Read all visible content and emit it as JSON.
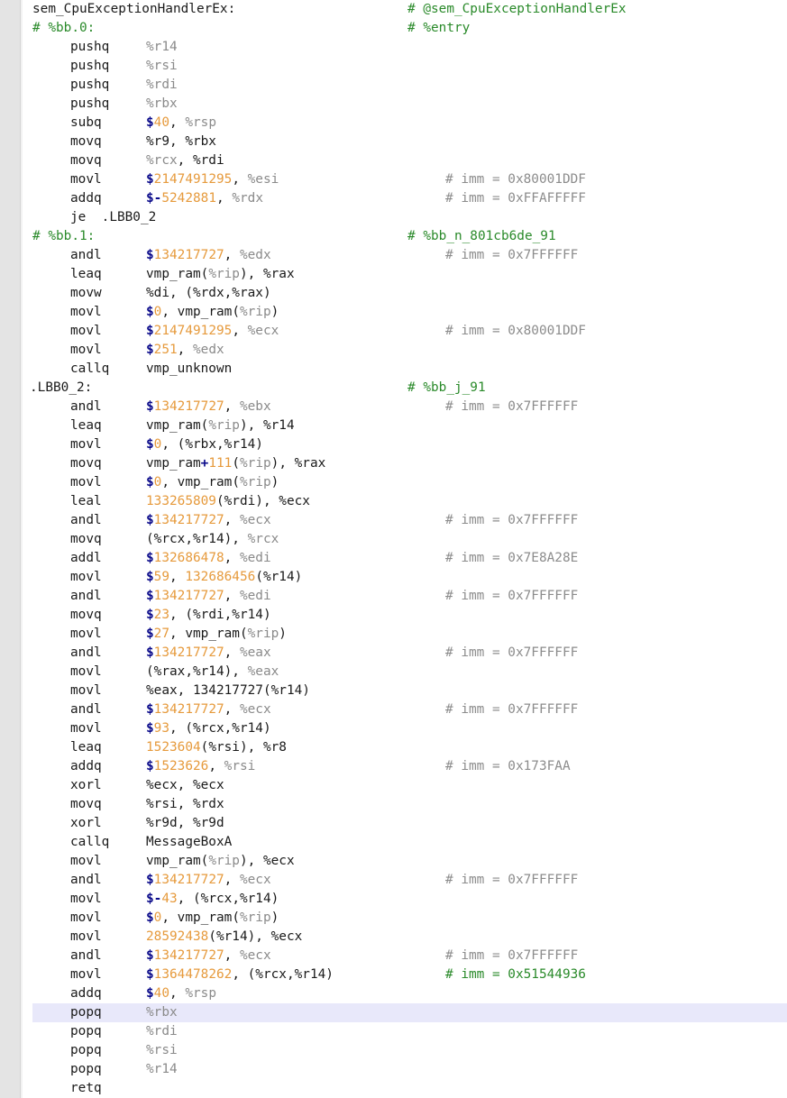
{
  "editor": {
    "lines": [
      {
        "kind": "label",
        "text": "sem_CpuExceptionHandlerEx:",
        "comment": "# @sem_CpuExceptionHandlerEx"
      },
      {
        "kind": "block",
        "text": "# %bb.0:",
        "comment": "# %entry"
      },
      {
        "kind": "instr",
        "mnemonic": "pushq",
        "ops": [
          {
            "t": "reg",
            "v": "%r14"
          }
        ]
      },
      {
        "kind": "instr",
        "mnemonic": "pushq",
        "ops": [
          {
            "t": "reg",
            "v": "%rsi"
          }
        ]
      },
      {
        "kind": "instr",
        "mnemonic": "pushq",
        "ops": [
          {
            "t": "reg",
            "v": "%rdi"
          }
        ]
      },
      {
        "kind": "instr",
        "mnemonic": "pushq",
        "ops": [
          {
            "t": "reg",
            "v": "%rbx"
          }
        ]
      },
      {
        "kind": "instr",
        "mnemonic": "subq",
        "ops": [
          {
            "t": "dol",
            "v": "$"
          },
          {
            "t": "num",
            "v": "40"
          },
          {
            "t": "sym",
            "v": ", "
          },
          {
            "t": "reg",
            "v": "%rsp"
          }
        ]
      },
      {
        "kind": "instr",
        "mnemonic": "movq",
        "ops": [
          {
            "t": "sym",
            "v": "%r9, %rbx"
          }
        ]
      },
      {
        "kind": "instr",
        "mnemonic": "movq",
        "ops": [
          {
            "t": "reg",
            "v": "%rcx"
          },
          {
            "t": "sym",
            "v": ", %rdi"
          }
        ]
      },
      {
        "kind": "instr",
        "mnemonic": "movl",
        "ops": [
          {
            "t": "dol",
            "v": "$"
          },
          {
            "t": "num",
            "v": "2147491295"
          },
          {
            "t": "sym",
            "v": ", "
          },
          {
            "t": "reg",
            "v": "%esi"
          }
        ],
        "imm": "# imm = 0x80001DDF"
      },
      {
        "kind": "instr",
        "mnemonic": "addq",
        "ops": [
          {
            "t": "dol",
            "v": "$"
          },
          {
            "t": "pl",
            "v": "-"
          },
          {
            "t": "num",
            "v": "5242881"
          },
          {
            "t": "sym",
            "v": ", "
          },
          {
            "t": "reg",
            "v": "%rdx"
          }
        ],
        "imm": "# imm = 0xFFAFFFFF"
      },
      {
        "kind": "instr",
        "mnemonic": "je",
        "raw": "je  .LBB0_2"
      },
      {
        "kind": "block",
        "text": "# %bb.1:",
        "comment": "# %bb_n_801cb6de_91"
      },
      {
        "kind": "instr",
        "mnemonic": "andl",
        "ops": [
          {
            "t": "dol",
            "v": "$"
          },
          {
            "t": "num",
            "v": "134217727"
          },
          {
            "t": "sym",
            "v": ", "
          },
          {
            "t": "reg",
            "v": "%edx"
          }
        ],
        "imm": "# imm = 0x7FFFFFF"
      },
      {
        "kind": "instr",
        "mnemonic": "leaq",
        "ops": [
          {
            "t": "sym",
            "v": "vmp_ram("
          },
          {
            "t": "reg",
            "v": "%rip"
          },
          {
            "t": "sym",
            "v": "), %rax"
          }
        ]
      },
      {
        "kind": "instr",
        "mnemonic": "movw",
        "ops": [
          {
            "t": "sym",
            "v": "%di, (%rdx,%rax)"
          }
        ]
      },
      {
        "kind": "instr",
        "mnemonic": "movl",
        "ops": [
          {
            "t": "dol",
            "v": "$"
          },
          {
            "t": "num",
            "v": "0"
          },
          {
            "t": "sym",
            "v": ", vmp_ram("
          },
          {
            "t": "reg",
            "v": "%rip"
          },
          {
            "t": "sym",
            "v": ")"
          }
        ]
      },
      {
        "kind": "instr",
        "mnemonic": "movl",
        "ops": [
          {
            "t": "dol",
            "v": "$"
          },
          {
            "t": "num",
            "v": "2147491295"
          },
          {
            "t": "sym",
            "v": ", "
          },
          {
            "t": "reg",
            "v": "%ecx"
          }
        ],
        "imm": "# imm = 0x80001DDF"
      },
      {
        "kind": "instr",
        "mnemonic": "movl",
        "ops": [
          {
            "t": "dol",
            "v": "$"
          },
          {
            "t": "num",
            "v": "251"
          },
          {
            "t": "sym",
            "v": ", "
          },
          {
            "t": "reg",
            "v": "%edx"
          }
        ]
      },
      {
        "kind": "instr",
        "mnemonic": "callq",
        "ops": [
          {
            "t": "sym",
            "v": "vmp_unknown"
          }
        ]
      },
      {
        "kind": "labeldot",
        "text": ".LBB0_2:",
        "comment": "# %bb_j_91"
      },
      {
        "kind": "instr",
        "mnemonic": "andl",
        "ops": [
          {
            "t": "dol",
            "v": "$"
          },
          {
            "t": "num",
            "v": "134217727"
          },
          {
            "t": "sym",
            "v": ", "
          },
          {
            "t": "reg",
            "v": "%ebx"
          }
        ],
        "imm": "# imm = 0x7FFFFFF"
      },
      {
        "kind": "instr",
        "mnemonic": "leaq",
        "ops": [
          {
            "t": "sym",
            "v": "vmp_ram("
          },
          {
            "t": "reg",
            "v": "%rip"
          },
          {
            "t": "sym",
            "v": "), %r14"
          }
        ]
      },
      {
        "kind": "instr",
        "mnemonic": "movl",
        "ops": [
          {
            "t": "dol",
            "v": "$"
          },
          {
            "t": "num",
            "v": "0"
          },
          {
            "t": "sym",
            "v": ", (%rbx,%r14)"
          }
        ]
      },
      {
        "kind": "instr",
        "mnemonic": "movq",
        "ops": [
          {
            "t": "sym",
            "v": "vmp_ram"
          },
          {
            "t": "pl",
            "v": "+"
          },
          {
            "t": "num",
            "v": "111"
          },
          {
            "t": "sym",
            "v": "("
          },
          {
            "t": "reg",
            "v": "%rip"
          },
          {
            "t": "sym",
            "v": "), %rax"
          }
        ]
      },
      {
        "kind": "instr",
        "mnemonic": "movl",
        "ops": [
          {
            "t": "dol",
            "v": "$"
          },
          {
            "t": "num",
            "v": "0"
          },
          {
            "t": "sym",
            "v": ", vmp_ram("
          },
          {
            "t": "reg",
            "v": "%rip"
          },
          {
            "t": "sym",
            "v": ")"
          }
        ]
      },
      {
        "kind": "instr",
        "mnemonic": "leal",
        "ops": [
          {
            "t": "num",
            "v": "133265809"
          },
          {
            "t": "sym",
            "v": "(%rdi), %ecx"
          }
        ]
      },
      {
        "kind": "instr",
        "mnemonic": "andl",
        "ops": [
          {
            "t": "dol",
            "v": "$"
          },
          {
            "t": "num",
            "v": "134217727"
          },
          {
            "t": "sym",
            "v": ", "
          },
          {
            "t": "reg",
            "v": "%ecx"
          }
        ],
        "imm": "# imm = 0x7FFFFFF"
      },
      {
        "kind": "instr",
        "mnemonic": "movq",
        "ops": [
          {
            "t": "sym",
            "v": "(%rcx,%r14), "
          },
          {
            "t": "reg",
            "v": "%rcx"
          }
        ]
      },
      {
        "kind": "instr",
        "mnemonic": "addl",
        "ops": [
          {
            "t": "dol",
            "v": "$"
          },
          {
            "t": "num",
            "v": "132686478"
          },
          {
            "t": "sym",
            "v": ", "
          },
          {
            "t": "reg",
            "v": "%edi"
          }
        ],
        "imm": "# imm = 0x7E8A28E"
      },
      {
        "kind": "instr",
        "mnemonic": "movl",
        "ops": [
          {
            "t": "dol",
            "v": "$"
          },
          {
            "t": "num",
            "v": "59"
          },
          {
            "t": "sym",
            "v": ", "
          },
          {
            "t": "num",
            "v": "132686456"
          },
          {
            "t": "sym",
            "v": "(%r14)"
          }
        ]
      },
      {
        "kind": "instr",
        "mnemonic": "andl",
        "ops": [
          {
            "t": "dol",
            "v": "$"
          },
          {
            "t": "num",
            "v": "134217727"
          },
          {
            "t": "sym",
            "v": ", "
          },
          {
            "t": "reg",
            "v": "%edi"
          }
        ],
        "imm": "# imm = 0x7FFFFFF"
      },
      {
        "kind": "instr",
        "mnemonic": "movq",
        "ops": [
          {
            "t": "dol",
            "v": "$"
          },
          {
            "t": "num",
            "v": "23"
          },
          {
            "t": "sym",
            "v": ", (%rdi,%r14)"
          }
        ]
      },
      {
        "kind": "instr",
        "mnemonic": "movl",
        "ops": [
          {
            "t": "dol",
            "v": "$"
          },
          {
            "t": "num",
            "v": "27"
          },
          {
            "t": "sym",
            "v": ", vmp_ram("
          },
          {
            "t": "reg",
            "v": "%rip"
          },
          {
            "t": "sym",
            "v": ")"
          }
        ]
      },
      {
        "kind": "instr",
        "mnemonic": "andl",
        "ops": [
          {
            "t": "dol",
            "v": "$"
          },
          {
            "t": "num",
            "v": "134217727"
          },
          {
            "t": "sym",
            "v": ", "
          },
          {
            "t": "reg",
            "v": "%eax"
          }
        ],
        "imm": "# imm = 0x7FFFFFF"
      },
      {
        "kind": "instr",
        "mnemonic": "movl",
        "ops": [
          {
            "t": "sym",
            "v": "(%rax,%r14), "
          },
          {
            "t": "reg",
            "v": "%eax"
          }
        ]
      },
      {
        "kind": "instr",
        "mnemonic": "movl",
        "ops": [
          {
            "t": "sym",
            "v": "%eax, 134217727(%r14)"
          }
        ]
      },
      {
        "kind": "instr",
        "mnemonic": "andl",
        "ops": [
          {
            "t": "dol",
            "v": "$"
          },
          {
            "t": "num",
            "v": "134217727"
          },
          {
            "t": "sym",
            "v": ", "
          },
          {
            "t": "reg",
            "v": "%ecx"
          }
        ],
        "imm": "# imm = 0x7FFFFFF"
      },
      {
        "kind": "instr",
        "mnemonic": "movl",
        "ops": [
          {
            "t": "dol",
            "v": "$"
          },
          {
            "t": "num",
            "v": "93"
          },
          {
            "t": "sym",
            "v": ", (%rcx,%r14)"
          }
        ]
      },
      {
        "kind": "instr",
        "mnemonic": "leaq",
        "ops": [
          {
            "t": "num",
            "v": "1523604"
          },
          {
            "t": "sym",
            "v": "(%rsi), %r8"
          }
        ]
      },
      {
        "kind": "instr",
        "mnemonic": "addq",
        "ops": [
          {
            "t": "dol",
            "v": "$"
          },
          {
            "t": "num",
            "v": "1523626"
          },
          {
            "t": "sym",
            "v": ", "
          },
          {
            "t": "reg",
            "v": "%rsi"
          }
        ],
        "imm": "# imm = 0x173FAA"
      },
      {
        "kind": "instr",
        "mnemonic": "xorl",
        "ops": [
          {
            "t": "sym",
            "v": "%ecx, %ecx"
          }
        ]
      },
      {
        "kind": "instr",
        "mnemonic": "movq",
        "ops": [
          {
            "t": "sym",
            "v": "%rsi, %rdx"
          }
        ]
      },
      {
        "kind": "instr",
        "mnemonic": "xorl",
        "ops": [
          {
            "t": "sym",
            "v": "%r9d, %r9d"
          }
        ]
      },
      {
        "kind": "instr",
        "mnemonic": "callq",
        "ops": [
          {
            "t": "sym",
            "v": "MessageBoxA"
          }
        ]
      },
      {
        "kind": "instr",
        "mnemonic": "movl",
        "ops": [
          {
            "t": "sym",
            "v": "vmp_ram("
          },
          {
            "t": "reg",
            "v": "%rip"
          },
          {
            "t": "sym",
            "v": "), %ecx"
          }
        ]
      },
      {
        "kind": "instr",
        "mnemonic": "andl",
        "ops": [
          {
            "t": "dol",
            "v": "$"
          },
          {
            "t": "num",
            "v": "134217727"
          },
          {
            "t": "sym",
            "v": ", "
          },
          {
            "t": "reg",
            "v": "%ecx"
          }
        ],
        "imm": "# imm = 0x7FFFFFF"
      },
      {
        "kind": "instr",
        "mnemonic": "movl",
        "ops": [
          {
            "t": "dol",
            "v": "$"
          },
          {
            "t": "pl",
            "v": "-"
          },
          {
            "t": "num",
            "v": "43"
          },
          {
            "t": "sym",
            "v": ", (%rcx,%r14)"
          }
        ]
      },
      {
        "kind": "instr",
        "mnemonic": "movl",
        "ops": [
          {
            "t": "dol",
            "v": "$"
          },
          {
            "t": "num",
            "v": "0"
          },
          {
            "t": "sym",
            "v": ", vmp_ram("
          },
          {
            "t": "reg",
            "v": "%rip"
          },
          {
            "t": "sym",
            "v": ")"
          }
        ]
      },
      {
        "kind": "instr",
        "mnemonic": "movl",
        "ops": [
          {
            "t": "num",
            "v": "28592438"
          },
          {
            "t": "sym",
            "v": "(%r14), %ecx"
          }
        ]
      },
      {
        "kind": "instr",
        "mnemonic": "andl",
        "ops": [
          {
            "t": "dol",
            "v": "$"
          },
          {
            "t": "num",
            "v": "134217727"
          },
          {
            "t": "sym",
            "v": ", "
          },
          {
            "t": "reg",
            "v": "%ecx"
          }
        ],
        "imm": "# imm = 0x7FFFFFF"
      },
      {
        "kind": "instr",
        "mnemonic": "movl",
        "ops": [
          {
            "t": "dol",
            "v": "$"
          },
          {
            "t": "num",
            "v": "1364478262"
          },
          {
            "t": "sym",
            "v": ", (%rcx,%r14)"
          }
        ],
        "imm": "# imm = 0x51544936",
        "immGreen": true
      },
      {
        "kind": "instr",
        "mnemonic": "addq",
        "ops": [
          {
            "t": "dol",
            "v": "$"
          },
          {
            "t": "num",
            "v": "40"
          },
          {
            "t": "sym",
            "v": ", "
          },
          {
            "t": "reg",
            "v": "%rsp"
          }
        ]
      },
      {
        "kind": "instr",
        "mnemonic": "popq",
        "ops": [
          {
            "t": "reg",
            "v": "%rbx"
          }
        ],
        "highlight": true
      },
      {
        "kind": "instr",
        "mnemonic": "popq",
        "ops": [
          {
            "t": "reg",
            "v": "%rdi"
          }
        ]
      },
      {
        "kind": "instr",
        "mnemonic": "popq",
        "ops": [
          {
            "t": "reg",
            "v": "%rsi"
          }
        ]
      },
      {
        "kind": "instr",
        "mnemonic": "popq",
        "ops": [
          {
            "t": "reg",
            "v": "%r14"
          }
        ]
      },
      {
        "kind": "instr",
        "mnemonic": "retq",
        "ops": []
      }
    ],
    "colors": {
      "gutter": "#e4e4e4",
      "register": "#8a8a8a",
      "number": "#e69a3c",
      "immediate_prefix": "#0a0a8a",
      "comment": "#2a8a2a",
      "highlight_line": "#e8e8fa"
    }
  }
}
